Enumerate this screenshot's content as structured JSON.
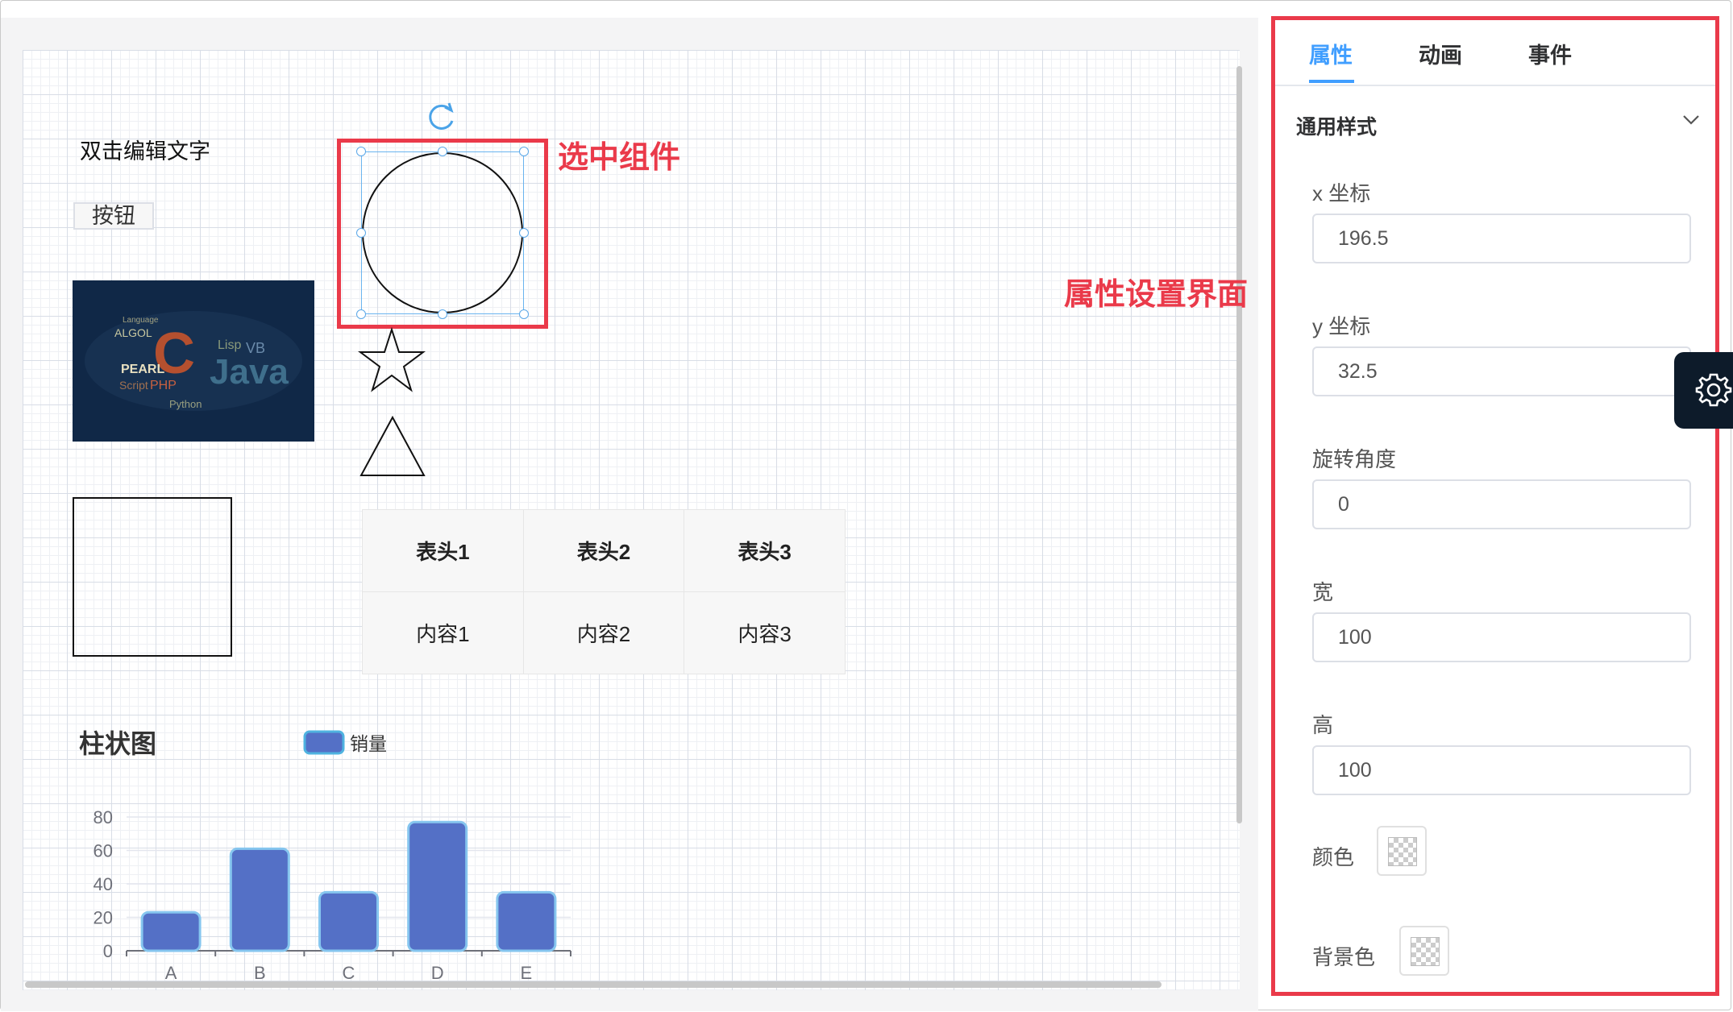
{
  "canvas": {
    "text_component": "双击编辑文字",
    "button_component": "按钮",
    "picture_words": [
      "Java",
      "C",
      "Lisp",
      "VB",
      "ALGOL",
      "PEARL",
      "Script",
      "PHP",
      "Python",
      "Language"
    ],
    "table": {
      "headers": [
        "表头1",
        "表头2",
        "表头3"
      ],
      "rows": [
        [
          "内容1",
          "内容2",
          "内容3"
        ]
      ]
    }
  },
  "annotations": {
    "selected": "选中组件",
    "panel": "属性设置界面"
  },
  "chart_data": {
    "type": "bar",
    "title": "柱状图",
    "categories": [
      "A",
      "B",
      "C",
      "D",
      "E"
    ],
    "series": [
      {
        "name": "销量",
        "values": [
          23,
          61,
          35,
          77,
          35
        ]
      }
    ],
    "ylim": [
      0,
      80
    ],
    "yticks": [
      0,
      20,
      40,
      60,
      80
    ],
    "legend_position": "top-center",
    "bar_color": "#5470c6",
    "grid": true
  },
  "panel": {
    "tabs": [
      "属性",
      "动画",
      "事件"
    ],
    "active_tab": "属性",
    "section_title": "通用样式",
    "fields": {
      "x_label": "x 坐标",
      "x_value": "196.5",
      "y_label": "y 坐标",
      "y_value": "32.5",
      "rotate_label": "旋转角度",
      "rotate_value": "0",
      "width_label": "宽",
      "width_value": "100",
      "height_label": "高",
      "height_value": "100",
      "color_label": "颜色",
      "bgcolor_label": "背景色"
    }
  },
  "colors": {
    "accent": "#409eff",
    "annotation_red": "#ea3a4a",
    "selection_blue": "#6ab4ef",
    "bar": "#5470c6",
    "side_tab": "#0d1b2a"
  },
  "icons": {
    "rotate": "rotate-icon",
    "chevron": "chevron-down-icon",
    "settings": "gear-icon"
  }
}
